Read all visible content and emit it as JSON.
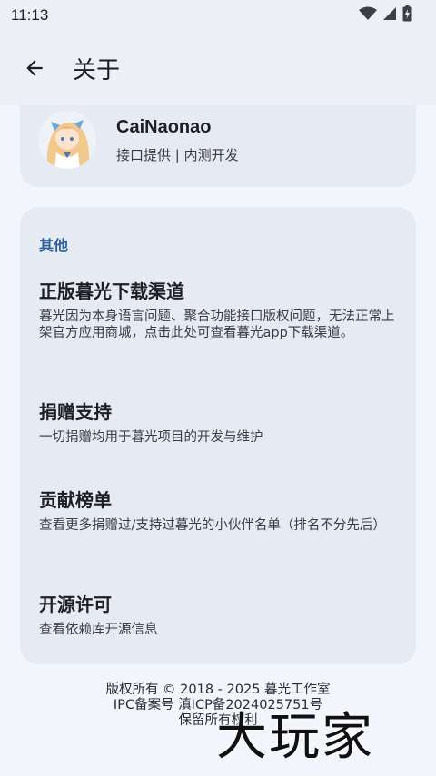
{
  "status_bar": {
    "time": "11:13"
  },
  "app_bar": {
    "title": "关于"
  },
  "developer": {
    "name": "CaiNaonao",
    "role": "接口提供 | 内测开发"
  },
  "section": {
    "title": "其他",
    "items": [
      {
        "title": "正版暮光下载渠道",
        "desc": "暮光因为本身语言问题、聚合功能接口版权问题，无法正常上架官方应用商城，点击此处可查看暮光app下载渠道。"
      },
      {
        "title": "捐赠支持",
        "desc": "一切捐赠均用于暮光项目的开发与维护"
      },
      {
        "title": "贡献榜单",
        "desc": "查看更多捐赠过/支持过暮光的小伙伴名单（排名不分先后）"
      },
      {
        "title": "开源许可",
        "desc": "查看依赖库开源信息"
      }
    ]
  },
  "footer": {
    "copyright": "版权所有 © 2018 - 2025 暮光工作室",
    "icp": "IPC备案号 滇ICP备2024025751号",
    "rights": "保留所有权利"
  },
  "watermark": {
    "text": "大玩家"
  }
}
